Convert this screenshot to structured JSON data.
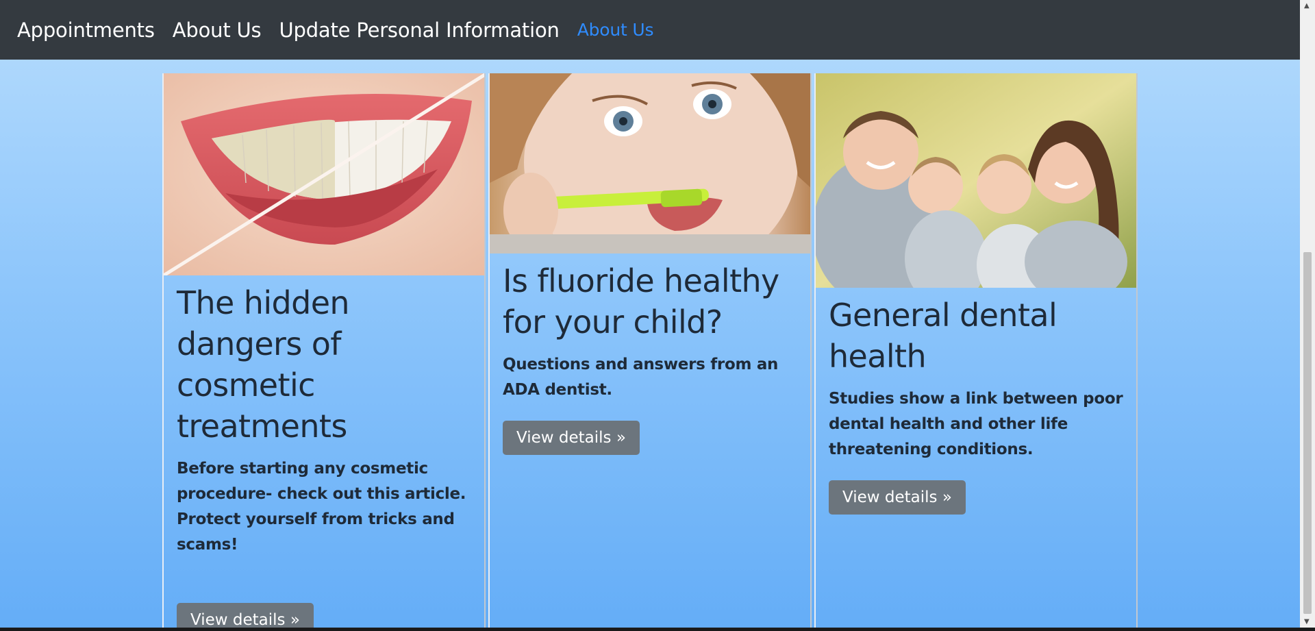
{
  "nav": {
    "items": [
      "Appointments",
      "About Us",
      "Update Personal Information"
    ],
    "active_item": "About Us"
  },
  "cards": [
    {
      "image": "smile-teeth-whitening-photo",
      "title": "The hidden dangers of cosmetic treatments",
      "text": "Before starting any cosmetic procedure- check out this article. Protect yourself from tricks and scams!",
      "button": "View details »"
    },
    {
      "image": "child-brushing-teeth-photo",
      "title": "Is fluoride healthy for your child?",
      "text": "Questions and answers from an ADA dentist.",
      "button": "View details »"
    },
    {
      "image": "happy-family-photo",
      "title": "General dental health",
      "text": "Studies show a link between poor dental health and other life threatening conditions.",
      "button": "View details »"
    }
  ],
  "colors": {
    "navbar": "#343a40",
    "nav_active": "#2f8cff",
    "button": "#6c757d",
    "background_top": "#b6dcfd",
    "background_bottom": "#64adf7"
  }
}
